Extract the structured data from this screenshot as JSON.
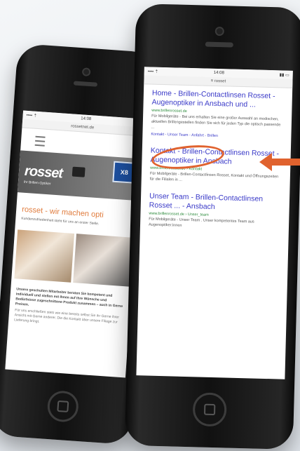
{
  "back_phone": {
    "status_left": "•••• ⇡",
    "status_center": "14:08",
    "status_right": "▮▮",
    "url": "rossetnet.de",
    "logo_text": "rosset",
    "logo_sub": "ihr Brillen-Optiker",
    "badge_text": "X8",
    "heading": "rosset - wir machen opti",
    "intro": "Kundenzufriedenheit steht für uns an erster Stelle.",
    "para1": "Unsere geschulten Mitarbeiter beraten Sie kompetent und individuell und stellen mit Ihnen auf Ihre Wünsche und Bedürfnisse zugeschnittene Produkt zusammen – auch in Gerne Preisen.",
    "para2": "Für uns erschließen stets wie eine bereits selbst Sie ihr Gerne ihrer Ansicht mit Gerne anderer. Die die Kontakt über unsere Filiage zur Lieferung bringt."
  },
  "front_phone": {
    "status_left": "•••• ⇡",
    "status_center": "14:08",
    "status_right": "▮▮ ▭",
    "url": "≡ rosset",
    "results": [
      {
        "title": "Home - Brillen-Contactlinsen Rosset - Augenoptiker in Ansbach und ...",
        "url": "www.brillenrosset.de",
        "snippet": "Für Mobilgeräte - Bei uns erhalten Sie eine großer Auswahl an modischen, aktuellen Brillengestellen finden Sie sich für jeden Typ die optisch passende ...",
        "links": "Kontakt - Unser Team - Anfahrt - Brillen"
      },
      {
        "title": "Kontakt - Brillen-Contactlinsen Rosset - Augenoptiker in Ansbach",
        "url": "www.brillenrosset.de › Kontakt",
        "snippet": "Für Mobilgeräte - Brillen-Contactlinsen Rosset, Kontakt und Öffnungszeiten für die Filialen in ...",
        "links": ""
      },
      {
        "title": "Unser Team - Brillen-Contactlinsen Rosset ... - Ansbach",
        "url": "www.brillenrosset.de › Unser_team",
        "snippet": "Für Mobilgeräte - Unser Team . Unser kompetentes Team aus Augenoptiker:innen",
        "links": ""
      }
    ]
  },
  "colors": {
    "accent": "#e0622e",
    "link": "#3a3ac8",
    "url_green": "#2a8a3a"
  }
}
